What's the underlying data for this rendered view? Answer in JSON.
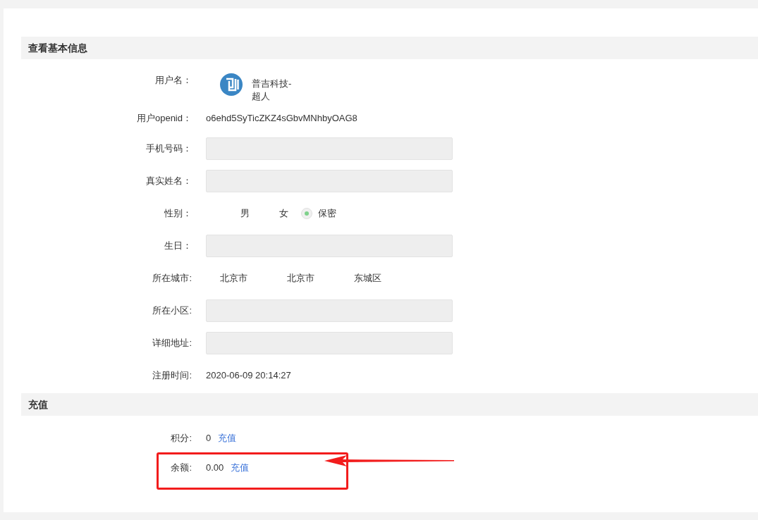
{
  "basic_info": {
    "title": "查看基本信息",
    "fields": [
      {
        "kind": "avatar",
        "label": "用户名：",
        "value": "普吉科技-超人"
      },
      {
        "kind": "text",
        "label": "用户openid：",
        "value": "o6ehd5SyTicZKZ4sGbvMNhbyOAG8"
      },
      {
        "kind": "input",
        "label": "手机号码："
      },
      {
        "kind": "input",
        "label": "真实姓名："
      },
      {
        "kind": "radio",
        "label": "性别：",
        "options": [
          {
            "label": "男",
            "selected": false
          },
          {
            "label": "女",
            "selected": false
          },
          {
            "label": "保密",
            "selected": true
          }
        ]
      },
      {
        "kind": "input",
        "label": "生日："
      },
      {
        "kind": "multi",
        "label": "所在城市:",
        "values": [
          "北京市",
          "北京市",
          "东城区"
        ]
      },
      {
        "kind": "input",
        "label": "所在小区:"
      },
      {
        "kind": "input",
        "label": "详细地址:"
      },
      {
        "kind": "text",
        "label": "注册时间:",
        "value": "2020-06-09 20:14:27"
      }
    ]
  },
  "recharge": {
    "title": "充值",
    "rows": [
      {
        "label": "积分:",
        "value": "0",
        "link": "充值",
        "highlighted": false
      },
      {
        "label": "余额:",
        "value": "0.00",
        "link": "充值",
        "highlighted": true
      }
    ]
  }
}
